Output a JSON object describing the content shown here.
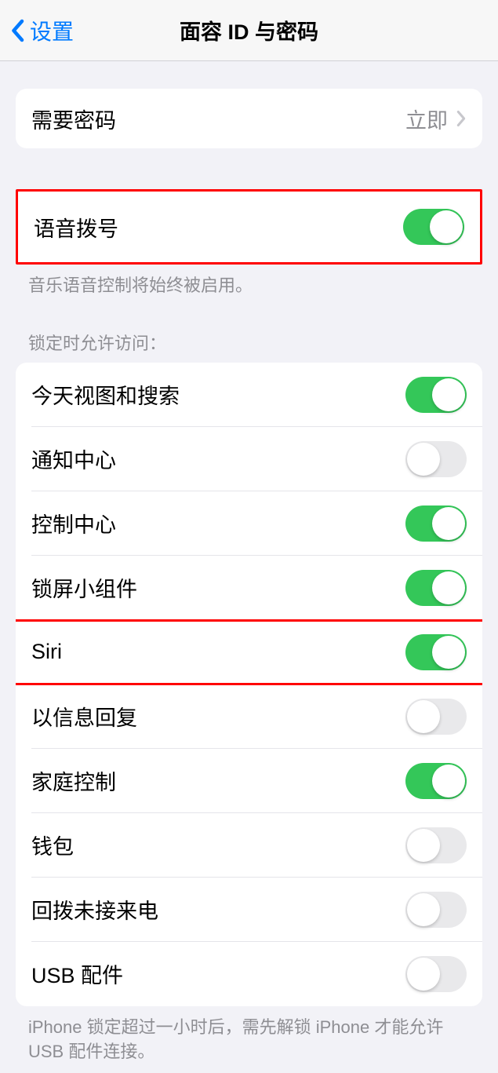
{
  "nav": {
    "back_label": "设置",
    "title": "面容 ID 与密码"
  },
  "passcode": {
    "label": "需要密码",
    "value": "立即"
  },
  "voice_dial": {
    "label": "语音拨号",
    "enabled": true,
    "footer": "音乐语音控制将始终被启用。"
  },
  "locked_access": {
    "header": "锁定时允许访问：",
    "items": [
      {
        "label": "今天视图和搜索",
        "enabled": true
      },
      {
        "label": "通知中心",
        "enabled": false
      },
      {
        "label": "控制中心",
        "enabled": true
      },
      {
        "label": "锁屏小组件",
        "enabled": true
      },
      {
        "label": "Siri",
        "enabled": true
      },
      {
        "label": "以信息回复",
        "enabled": false
      },
      {
        "label": "家庭控制",
        "enabled": true
      },
      {
        "label": "钱包",
        "enabled": false
      },
      {
        "label": "回拨未接来电",
        "enabled": false
      },
      {
        "label": "USB 配件",
        "enabled": false
      }
    ],
    "footer": "iPhone 锁定超过一小时后，需先解锁 iPhone 才能允许 USB 配件连接。"
  }
}
